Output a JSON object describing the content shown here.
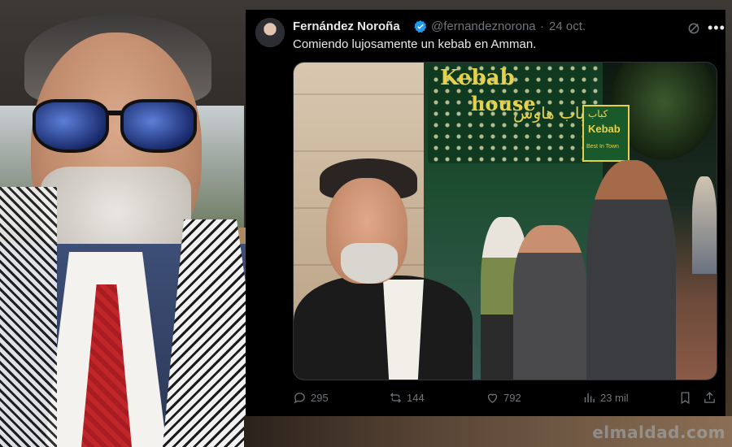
{
  "tweet": {
    "author_name": "Fernández Noroña",
    "handle": "@fernandeznorona",
    "separator": "·",
    "date": "24 oct.",
    "text": "Comiendo lujosamente un kebab en Amman.",
    "replies": "295",
    "retweets": "144",
    "likes": "792",
    "views": "23 mil"
  },
  "photo_signs": {
    "main_line_1": "Kebab",
    "main_line_2": "house",
    "main_arabic": "كباب هاوس",
    "side_arabic": "كباب",
    "side_line_1": "Kebab",
    "side_line_2": "Best In Town"
  },
  "watermark": "elmaldad.com",
  "colors": {
    "background": "#000000",
    "text_primary": "#e7e9ea",
    "text_secondary": "#71767b",
    "verified_blue": "#1d9bf0",
    "sign_yellow": "#e8d14a"
  }
}
